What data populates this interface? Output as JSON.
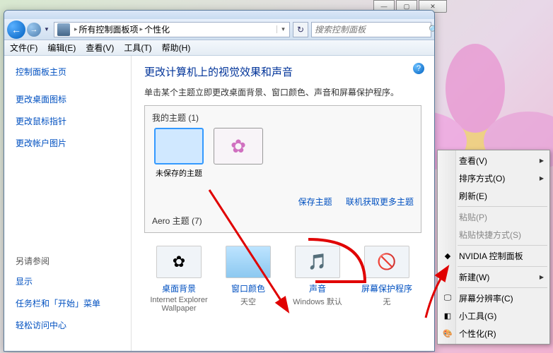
{
  "window": {
    "breadcrumb": {
      "root": "所有控制面板项",
      "current": "个性化"
    },
    "search_placeholder": "搜索控制面板"
  },
  "menubar": {
    "file": "文件(F)",
    "edit": "编辑(E)",
    "view": "查看(V)",
    "tools": "工具(T)",
    "help": "帮助(H)"
  },
  "sidebar": {
    "home": "控制面板主页",
    "links": [
      "更改桌面图标",
      "更改鼠标指针",
      "更改帐户图片"
    ],
    "see_also": "另请参阅",
    "also_links": [
      "显示",
      "任务栏和「开始」菜单",
      "轻松访问中心"
    ]
  },
  "main": {
    "title": "更改计算机上的视觉效果和声音",
    "subtitle": "单击某个主题立即更改桌面背景、窗口颜色、声音和屏幕保护程序。",
    "my_themes_header": "我的主题 (1)",
    "unsaved_theme": "未保存的主题",
    "save_theme": "保存主题",
    "get_more": "联机获取更多主题",
    "aero_header": "Aero 主题 (7)"
  },
  "bottom": {
    "items": [
      {
        "label": "桌面背景",
        "sub": "Internet Explorer Wallpaper"
      },
      {
        "label": "窗口颜色",
        "sub": "天空"
      },
      {
        "label": "声音",
        "sub": "Windows 默认"
      },
      {
        "label": "屏幕保护程序",
        "sub": "无"
      }
    ]
  },
  "context_menu": {
    "view": "查看(V)",
    "sort": "排序方式(O)",
    "refresh": "刷新(E)",
    "paste": "粘贴(P)",
    "paste_shortcut": "粘贴快捷方式(S)",
    "nvidia": "NVIDIA 控制面板",
    "new": "新建(W)",
    "resolution": "屏幕分辨率(C)",
    "gadgets": "小工具(G)",
    "personalize": "个性化(R)"
  }
}
